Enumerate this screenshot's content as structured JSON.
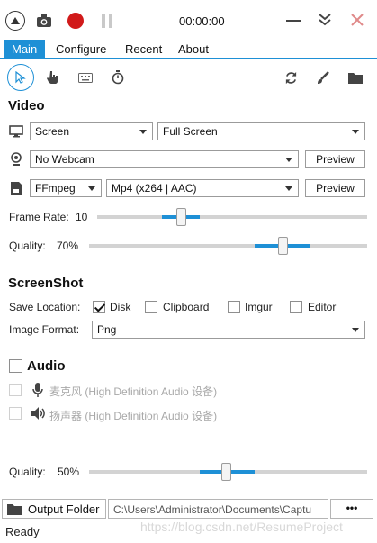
{
  "titlebar": {
    "timer": "00:00:00"
  },
  "menu": {
    "tabs": [
      "Main",
      "Configure",
      "Recent",
      "About"
    ],
    "active": "Main"
  },
  "video": {
    "heading": "Video",
    "source": "Screen",
    "region": "Full Screen",
    "webcam": "No Webcam",
    "webcam_preview": "Preview",
    "encoder": "FFmpeg",
    "format": "Mp4 (x264 | AAC)",
    "format_preview": "Preview",
    "frame_rate_label": "Frame Rate:",
    "frame_rate_value": "10",
    "quality_label": "Quality:",
    "quality_value": "70%",
    "frame_rate_level": 0.3,
    "quality_level": 0.7
  },
  "screenshot": {
    "heading": "ScreenShot",
    "save_location_label": "Save Location:",
    "options": [
      {
        "label": "Disk",
        "checked": true
      },
      {
        "label": "Clipboard",
        "checked": false
      },
      {
        "label": "Imgur",
        "checked": false
      },
      {
        "label": "Editor",
        "checked": false
      }
    ],
    "image_format_label": "Image Format:",
    "image_format": "Png"
  },
  "audio": {
    "heading": "Audio",
    "devices": [
      {
        "label": "麦克风 (High Definition Audio 设备)",
        "icon": "microphone-icon"
      },
      {
        "label": "扬声器 (High Definition Audio 设备)",
        "icon": "speaker-icon"
      }
    ],
    "quality_label": "Quality:",
    "quality_value": "50%",
    "quality_level": 0.5
  },
  "footer": {
    "output_folder_label": "Output Folder",
    "output_path": "C:\\Users\\Administrator\\Documents\\Captu",
    "more_label": "•••"
  },
  "status": {
    "text": "Ready"
  },
  "watermark": "https://blog.csdn.net/ResumeProject",
  "colors": {
    "accent": "#1e90d6",
    "record": "#d11a1a"
  }
}
